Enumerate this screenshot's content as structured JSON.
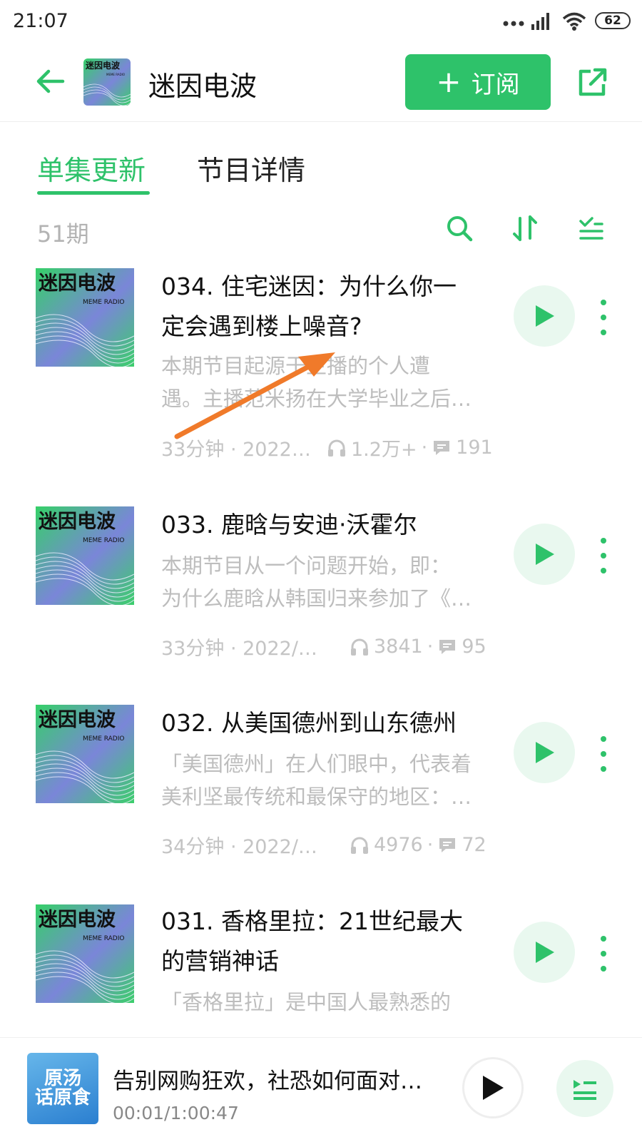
{
  "status_bar": {
    "time": "21:07",
    "battery": "62"
  },
  "header": {
    "title": "迷因电波",
    "subscribe_label": "订阅"
  },
  "tabs": [
    {
      "label": "单集更新"
    },
    {
      "label": "节目详情"
    }
  ],
  "toolbar": {
    "count": "51期"
  },
  "cover_art": {
    "title": "迷因电波",
    "subtitle": "MEME RADIO",
    "header_title": "迷因电波",
    "header_subtitle": "MEME RADIO"
  },
  "episodes": [
    {
      "title_line1": "034. 住宅迷因：为什么你一",
      "title_line2": "定会遇到楼上噪音?",
      "desc_line1": "本期节目起源于主播的个人遭",
      "desc_line2": "遇。主播范米扬在大学毕业之后…",
      "duration": "33分钟 · 2022…",
      "plays": "1.2万+",
      "comments": "191"
    },
    {
      "title_line1": "033. 鹿晗与安迪·沃霍尔",
      "desc_line1": "本期节目从一个问题开始，即：",
      "desc_line2": "为什么鹿晗从韩国归来参加了《…",
      "duration": "33分钟 · 2022/1…",
      "plays": "3841",
      "comments": "95"
    },
    {
      "title_line1": "032. 从美国德州到山东德州",
      "desc_line1": "「美国德州」在人们眼中，代表着",
      "desc_line2": "美利坚最传统和最保守的地区：…",
      "duration": "34分钟 · 2022/1…",
      "plays": "4976",
      "comments": "72"
    },
    {
      "title_line1": "031. 香格里拉：21世纪最大",
      "title_line2": "的营销神话",
      "desc_line1": "「香格里拉」是中国人最熟悉的"
    }
  ],
  "player": {
    "title": "告别网购狂欢，社恐如何面对…",
    "time": "00:01/1:00:47",
    "cover_text_line1": "原汤",
    "cover_text_line2": "话原食"
  },
  "colors": {
    "accent": "#2ec26a",
    "annotation": "#f07a2a"
  },
  "icons": [
    "back-arrow-icon",
    "share-icon",
    "search-icon",
    "sort-icon",
    "filter-icon",
    "play-icon",
    "more-icon",
    "headphones-icon",
    "comment-icon",
    "playlist-icon"
  ]
}
